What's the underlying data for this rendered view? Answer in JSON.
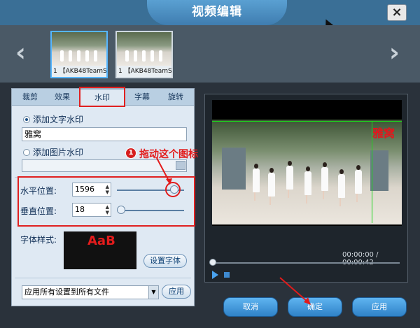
{
  "window": {
    "title": "视频编辑",
    "close_label": "×"
  },
  "thumbnails": [
    {
      "label": "1 【AKB48TeamS..."
    },
    {
      "label": "1 【AKB48TeamS..."
    }
  ],
  "nav": {
    "prev": "‹",
    "next": "›"
  },
  "tabs": [
    "裁剪",
    "效果",
    "水印",
    "字幕",
    "旋转"
  ],
  "active_tab": "水印",
  "watermark": {
    "text_option_label": "添加文字水印",
    "text_value": "雅窝",
    "image_option_label": "添加图片水印"
  },
  "position": {
    "horizontal_label": "水平位置:",
    "horizontal_value": "1596",
    "vertical_label": "垂直位置:",
    "vertical_value": "18"
  },
  "font": {
    "style_label": "字体样式:",
    "preview_text": "AaB",
    "set_font_button": "设置字体"
  },
  "apply_all": {
    "select_value": "应用所有设置到所有文件",
    "apply_button": "应用"
  },
  "preview": {
    "watermark_text": "雅窝",
    "current_time": "00:00:00",
    "separator": "/",
    "total_time": "00:00:42"
  },
  "annotation": {
    "badge": "1",
    "text": "拖动这个图标"
  },
  "buttons": {
    "cancel": "取消",
    "confirm": "确定",
    "apply": "应用"
  },
  "colors": {
    "accent": "#3f8fd6",
    "annotation_red": "#e21b1b",
    "guide_green": "#1cd61c"
  }
}
